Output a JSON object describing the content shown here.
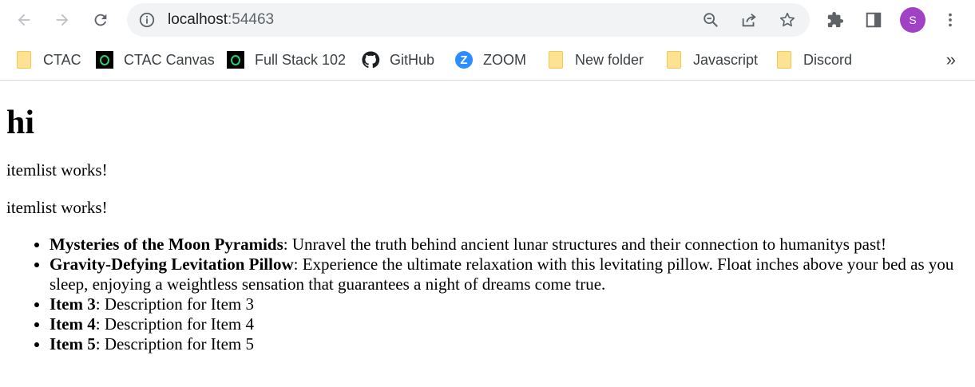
{
  "browser": {
    "url_host": "localhost",
    "url_port": ":54463",
    "profile_initial": "S",
    "bookmarks": [
      {
        "label": "CTAC",
        "icon": "folder-icon"
      },
      {
        "label": "CTAC Canvas",
        "icon": "canvas-icon"
      },
      {
        "label": "Full Stack 102",
        "icon": "canvas-icon"
      },
      {
        "label": "GitHub",
        "icon": "github-icon"
      },
      {
        "label": "ZOOM",
        "icon": "zoom-icon"
      },
      {
        "label": "New folder",
        "icon": "folder-icon"
      },
      {
        "label": "Javascript",
        "icon": "folder-icon"
      },
      {
        "label": "Discord",
        "icon": "folder-icon"
      }
    ],
    "more_bookmarks": "»"
  },
  "page": {
    "heading": "hi",
    "paragraphs": [
      "itemlist works!",
      "itemlist works!"
    ],
    "items": [
      {
        "name": "Mysteries of the Moon Pyramids",
        "desc": ": Unravel the truth behind ancient lunar structures and their connection to humanitys past!"
      },
      {
        "name": "Gravity-Defying Levitation Pillow",
        "desc": ": Experience the ultimate relaxation with this levitating pillow. Float inches above your bed as you sleep, enjoying a weightless sensation that guarantees a night of dreams come true."
      },
      {
        "name": "Item 3",
        "desc": ": Description for Item 3"
      },
      {
        "name": "Item 4",
        "desc": ": Description for Item 4"
      },
      {
        "name": "Item 5",
        "desc": ": Description for Item 5"
      }
    ]
  }
}
